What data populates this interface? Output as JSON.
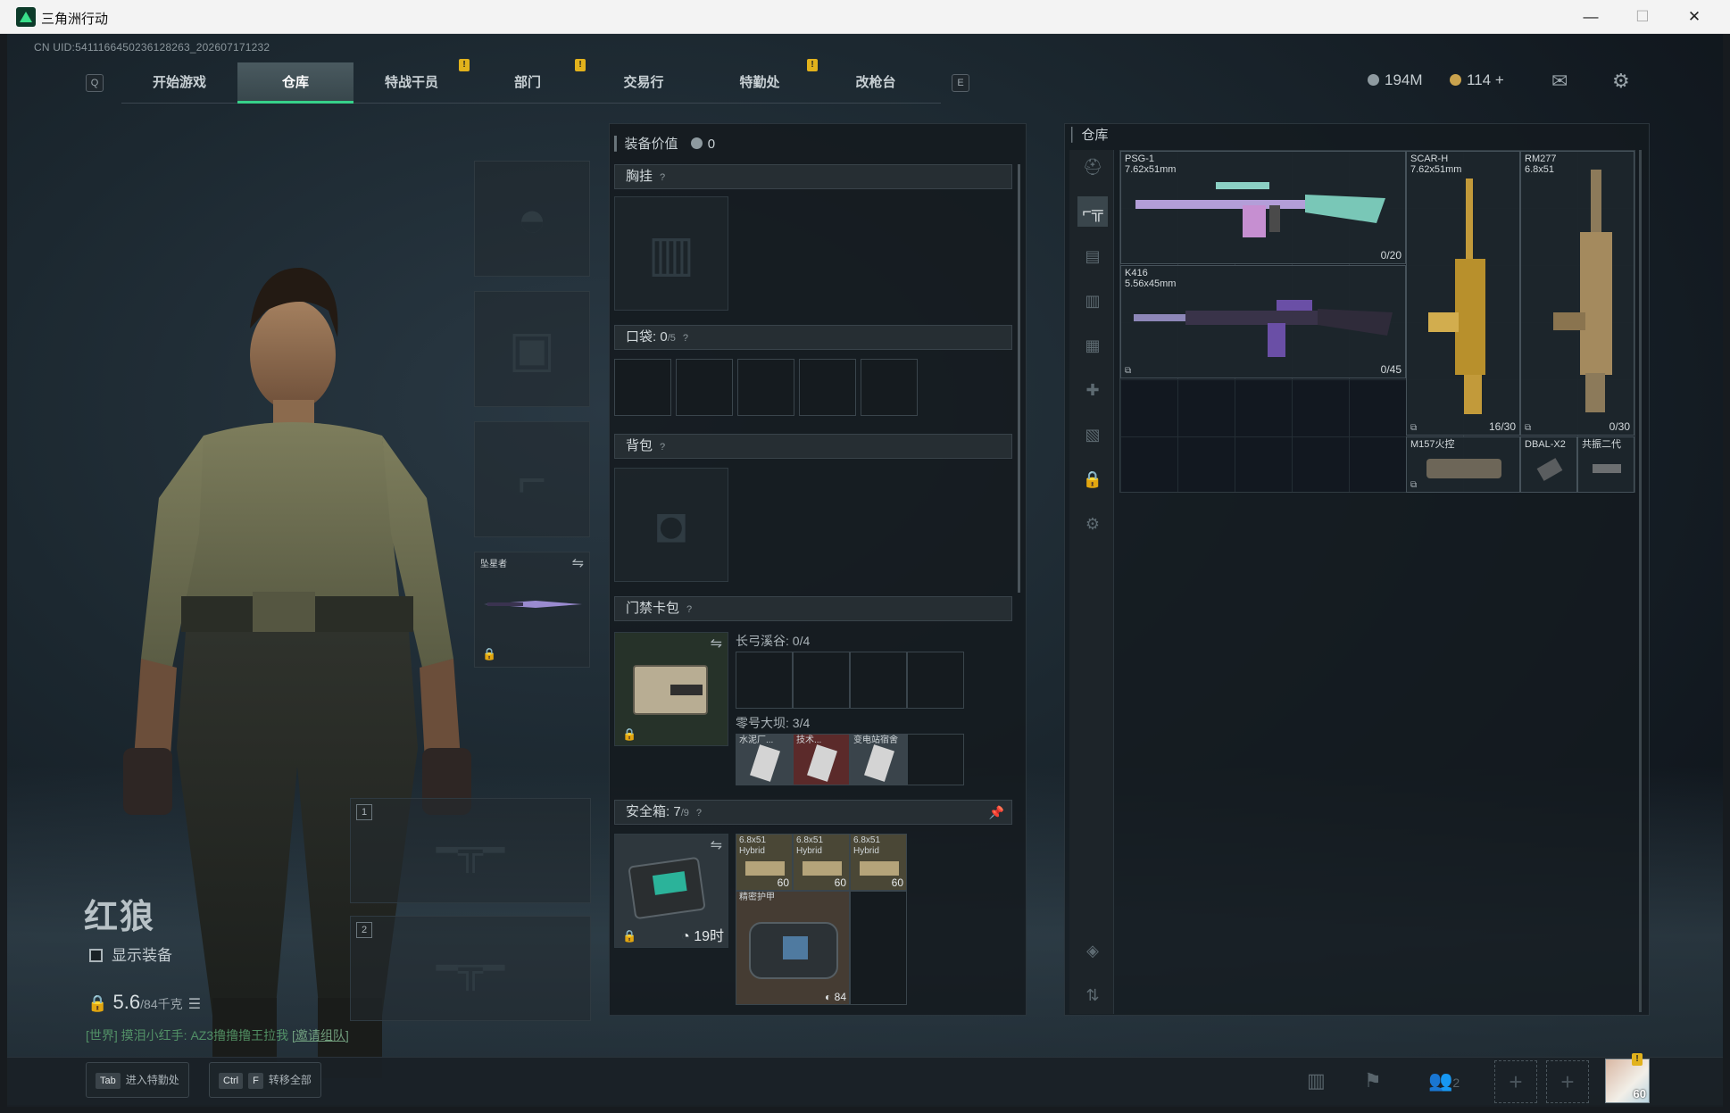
{
  "window": {
    "title": "三角洲行动",
    "min": "—",
    "max": "☐",
    "close": "✕"
  },
  "uid": "CN UID:5411166450236128263_202607171232",
  "nav": {
    "key_left": "Q",
    "key_right": "E",
    "tabs": [
      "开始游戏",
      "仓库",
      "特战干员",
      "部门",
      "交易行",
      "特勤处",
      "改枪台"
    ],
    "active": "仓库",
    "warn": "!"
  },
  "currency": {
    "silver": "194M",
    "gold": "114",
    "plus": "+"
  },
  "character": {
    "name": "红狼",
    "show_equipment": "显示装备",
    "weight": "5.6",
    "weight_max": "/84千克",
    "slot_weapon3_label": "坠星者",
    "slot1": "1",
    "slot2": "2"
  },
  "chat": {
    "prefix": "[世界]",
    "text": " 摸泪小红手: AZ3撸撸撸王拉我 ",
    "link": "[邀请组队]"
  },
  "bottom": {
    "tab_key": "Tab",
    "tab_label": "进入特勤处",
    "ctrl_key": "Ctrl",
    "f_key": "F",
    "f_label": "转移全部",
    "friends_count": "2",
    "level": "60"
  },
  "equipment": {
    "value_label": "装备价值",
    "value": "0",
    "chest_label": "胸挂",
    "pocket_label": "口袋:",
    "pocket_count": "0",
    "pocket_max": "/5",
    "backpack_label": "背包",
    "keycard_label": "门禁卡包",
    "map1": "长弓溪谷: 0/4",
    "map2": "零号大坝: 3/4",
    "keycards": [
      "水泥厂...",
      "技术...",
      "变电站宿舍"
    ],
    "safe_label": "安全箱:",
    "safe_count": "7",
    "safe_max": "/9",
    "safe_timer": "19时",
    "ammo": [
      {
        "name": "6.8x51\nHybrid",
        "count": "60"
      },
      {
        "name": "6.8x51\nHybrid",
        "count": "60"
      },
      {
        "name": "6.8x51\nHybrid",
        "count": "60"
      }
    ],
    "armor": {
      "name": "精密护甲",
      "count": "84"
    }
  },
  "warehouse": {
    "title": "仓库",
    "weapons": [
      {
        "name": "PSG-1\n7.62x51mm",
        "ammo": "0/20"
      },
      {
        "name": "K416\n5.56x45mm",
        "ammo": "0/45"
      },
      {
        "name": "SCAR-H\n7.62x51mm",
        "ammo": "16/30"
      },
      {
        "name": "RM277\n6.8x51",
        "ammo": "0/30"
      }
    ],
    "attachments": [
      "M157火控",
      "DBAL-X2",
      "共振二代"
    ]
  }
}
